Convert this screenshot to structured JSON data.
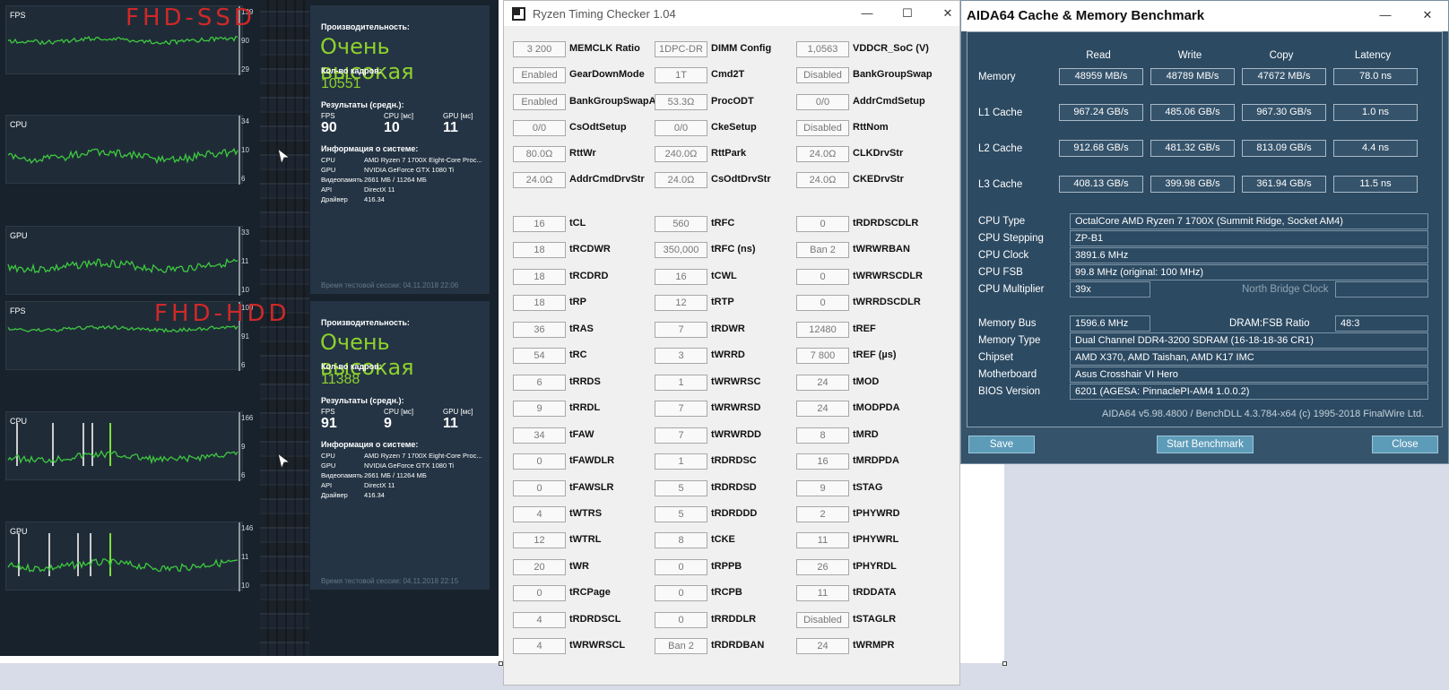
{
  "game": {
    "labels": {
      "fps": "FPS",
      "cpu": "CPU",
      "gpu": "GPU"
    },
    "scales": {
      "a_fps": [
        "139",
        "90",
        "29"
      ],
      "a_cpu": [
        "34",
        "10",
        "6"
      ],
      "a_gpu": [
        "33",
        "11",
        "10"
      ],
      "b_fps": [
        "100",
        "91",
        "6"
      ],
      "b_cpu": [
        "166",
        "9",
        "6"
      ],
      "b_gpu": [
        "146",
        "11",
        "10"
      ]
    },
    "handwriting": {
      "top": "FHD-SSD",
      "bottom": "FHD-HDD"
    },
    "results": [
      {
        "perf_label": "Производительность:",
        "rating": "Очень высокая",
        "frames_label": "Кол-во кадров:",
        "frames": "10551",
        "avg_label": "Результаты (средн.):",
        "fps_h": "FPS",
        "cpu_h": "CPU [мс]",
        "gpu_h": "GPU [мс]",
        "fps": "90",
        "cpu": "10",
        "gpu": "11",
        "info_label": "Информация о системе:",
        "sys": [
          [
            "CPU",
            "AMD Ryzen 7 1700X Eight-Core Proc..."
          ],
          [
            "GPU",
            "NVIDIA GeForce GTX 1080 Ti"
          ],
          [
            "Видеопамять",
            "2661 МБ / 11264 МБ"
          ],
          [
            "API",
            "DirectX 11"
          ],
          [
            "Драйвер",
            "416.34"
          ]
        ],
        "time": "Время тестовой сессии: 04.11.2018 22:06"
      },
      {
        "perf_label": "Производительность:",
        "rating": "Очень высокая",
        "frames_label": "Кол-во кадров:",
        "frames": "11388",
        "avg_label": "Результаты (средн.):",
        "fps_h": "FPS",
        "cpu_h": "CPU [мс]",
        "gpu_h": "GPU [мс]",
        "fps": "91",
        "cpu": "9",
        "gpu": "11",
        "info_label": "Информация о системе:",
        "sys": [
          [
            "CPU",
            "AMD Ryzen 7 1700X Eight-Core Proc..."
          ],
          [
            "GPU",
            "NVIDIA GeForce GTX 1080 Ti"
          ],
          [
            "Видеопамять",
            "2661 МБ / 11264 МБ"
          ],
          [
            "API",
            "DirectX 11"
          ],
          [
            "Драйвер",
            "416.34"
          ]
        ],
        "time": "Время тестовой сессии: 04.11.2018 22:15"
      }
    ]
  },
  "rtc": {
    "title": "Ryzen Timing Checker 1.04",
    "min": "—",
    "max": "☐",
    "close": "✕",
    "col1": [
      [
        "3 200",
        "MEMCLK Ratio"
      ],
      [
        "Enabled",
        "GearDownMode"
      ],
      [
        "Enabled",
        "BankGroupSwapAlt"
      ],
      [
        "0/0",
        "CsOdtSetup"
      ],
      [
        "80.0Ω",
        "RttWr"
      ],
      [
        "24.0Ω",
        "AddrCmdDrvStr"
      ]
    ],
    "col2": [
      [
        "1DPC-DR",
        "DIMM Config"
      ],
      [
        "1T",
        "Cmd2T"
      ],
      [
        "53.3Ω",
        "ProcODT"
      ],
      [
        "0/0",
        "CkeSetup"
      ],
      [
        "240.0Ω",
        "RttPark"
      ],
      [
        "24.0Ω",
        "CsOdtDrvStr"
      ]
    ],
    "col3": [
      [
        "1,0563",
        "VDDCR_SoC (V)"
      ],
      [
        "Disabled",
        "BankGroupSwap"
      ],
      [
        "0/0",
        "AddrCmdSetup"
      ],
      [
        "Disabled",
        "RttNom"
      ],
      [
        "24.0Ω",
        "CLKDrvStr"
      ],
      [
        "24.0Ω",
        "CKEDrvStr"
      ]
    ],
    "t1": [
      [
        "16",
        "tCL"
      ],
      [
        "18",
        "tRCDWR"
      ],
      [
        "18",
        "tRCDRD"
      ],
      [
        "18",
        "tRP"
      ],
      [
        "36",
        "tRAS"
      ],
      [
        "54",
        "tRC"
      ],
      [
        "6",
        "tRRDS"
      ],
      [
        "9",
        "tRRDL"
      ],
      [
        "34",
        "tFAW"
      ],
      [
        "0",
        "tFAWDLR"
      ],
      [
        "0",
        "tFAWSLR"
      ],
      [
        "4",
        "tWTRS"
      ],
      [
        "12",
        "tWTRL"
      ],
      [
        "20",
        "tWR"
      ],
      [
        "0",
        "tRCPage"
      ],
      [
        "4",
        "tRDRDSCL"
      ],
      [
        "4",
        "tWRWRSCL"
      ]
    ],
    "t2": [
      [
        "560",
        "tRFC"
      ],
      [
        "350,000",
        "tRFC (ns)"
      ],
      [
        "16",
        "tCWL"
      ],
      [
        "12",
        "tRTP"
      ],
      [
        "7",
        "tRDWR"
      ],
      [
        "3",
        "tWRRD"
      ],
      [
        "1",
        "tWRWRSC"
      ],
      [
        "7",
        "tWRWRSD"
      ],
      [
        "7",
        "tWRWRDD"
      ],
      [
        "1",
        "tRDRDSC"
      ],
      [
        "5",
        "tRDRDSD"
      ],
      [
        "5",
        "tRDRDDD"
      ],
      [
        "8",
        "tCKE"
      ],
      [
        "0",
        "tRPPB"
      ],
      [
        "0",
        "tRCPB"
      ],
      [
        "0",
        "tRRDDLR"
      ],
      [
        "Ban 2",
        "tRDRDBAN"
      ]
    ],
    "t3": [
      [
        "0",
        "tRDRDSCDLR"
      ],
      [
        "Ban 2",
        "tWRWRBAN"
      ],
      [
        "0",
        "tWRWRSCDLR"
      ],
      [
        "0",
        "tWRRDSCDLR"
      ],
      [
        "12480",
        "tREF"
      ],
      [
        "7 800",
        "tREF (µs)"
      ],
      [
        "24",
        "tMOD"
      ],
      [
        "24",
        "tMODPDA"
      ],
      [
        "8",
        "tMRD"
      ],
      [
        "16",
        "tMRDPDA"
      ],
      [
        "9",
        "tSTAG"
      ],
      [
        "2",
        "tPHYWRD"
      ],
      [
        "11",
        "tPHYWRL"
      ],
      [
        "26",
        "tPHYRDL"
      ],
      [
        "11",
        "tRDDATA"
      ],
      [
        "Disabled",
        "tSTAGLR"
      ],
      [
        "24",
        "tWRMPR"
      ]
    ]
  },
  "aida": {
    "title": "AIDA64 Cache & Memory Benchmark",
    "min": "—",
    "close": "✕",
    "headers": [
      "Read",
      "Write",
      "Copy",
      "Latency"
    ],
    "rows": [
      {
        "label": "Memory",
        "vals": [
          "48959 MB/s",
          "48789 MB/s",
          "47672 MB/s",
          "78.0 ns"
        ]
      },
      {
        "label": "L1 Cache",
        "vals": [
          "967.24 GB/s",
          "485.06 GB/s",
          "967.30 GB/s",
          "1.0 ns"
        ]
      },
      {
        "label": "L2 Cache",
        "vals": [
          "912.68 GB/s",
          "481.32 GB/s",
          "813.09 GB/s",
          "4.4 ns"
        ]
      },
      {
        "label": "L3 Cache",
        "vals": [
          "408.13 GB/s",
          "399.98 GB/s",
          "361.94 GB/s",
          "11.5 ns"
        ]
      }
    ],
    "info": [
      [
        "CPU Type",
        "OctalCore AMD Ryzen 7 1700X  (Summit Ridge, Socket AM4)"
      ],
      [
        "CPU Stepping",
        "ZP-B1"
      ],
      [
        "CPU Clock",
        "3891.6 MHz"
      ],
      [
        "CPU FSB",
        "99.8 MHz  (original: 100 MHz)"
      ],
      [
        "CPU Multiplier",
        "39x"
      ]
    ],
    "nb_label": "North Bridge Clock",
    "nb_value": "",
    "info2": [
      [
        "Memory Bus",
        "1596.6 MHz"
      ],
      [
        "Memory Type",
        "Dual Channel DDR4-3200 SDRAM  (16-18-18-36 CR1)"
      ],
      [
        "Chipset",
        "AMD X370, AMD Taishan, AMD K17 IMC"
      ],
      [
        "Motherboard",
        "Asus Crosshair VI Hero"
      ],
      [
        "BIOS Version",
        "6201  (AGESA: PinnaclePI-AM4 1.0.0.2)"
      ]
    ],
    "ratio_label": "DRAM:FSB Ratio",
    "ratio_value": "48:3",
    "footer": "AIDA64 v5.98.4800 / BenchDLL 4.3.784-x64  (c) 1995-2018 FinalWire Ltd.",
    "buttons": {
      "save": "Save",
      "start": "Start Benchmark",
      "close": "Close"
    }
  }
}
